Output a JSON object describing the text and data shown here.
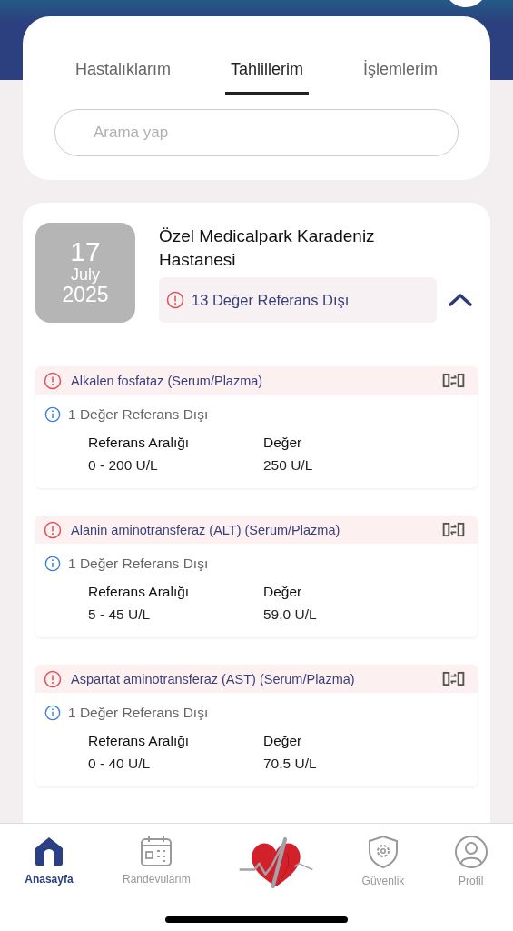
{
  "tabs": [
    {
      "label": "Hastalıklarım",
      "selected": false
    },
    {
      "label": "Tahlillerim",
      "selected": true
    },
    {
      "label": "İşlemlerim",
      "selected": false
    }
  ],
  "search": {
    "placeholder": "Arama yap"
  },
  "visit": {
    "day": "17",
    "month": "July",
    "year": "2025",
    "hospital": "Özel Medicalpark Karadeniz Hastanesi",
    "summary": "13 Değer Referans Dışı",
    "expanded": true
  },
  "tests": [
    {
      "name": "Alkalen fosfataz (Serum/Plazma)",
      "info": "1 Değer Referans Dışı",
      "range_label": "Referans Aralığı",
      "value_label": "Değer",
      "range": "0 - 200 U/L",
      "value": "250 U/L"
    },
    {
      "name": "Alanin aminotransferaz (ALT) (Serum/Plazma)",
      "info": "1 Değer Referans Dışı",
      "range_label": "Referans Aralığı",
      "value_label": "Değer",
      "range": "5 - 45 U/L",
      "value": "59,0 U/L"
    },
    {
      "name": "Aspartat aminotransferaz (AST) (Serum/Plazma)",
      "info": "1 Değer Referans Dışı",
      "range_label": "Referans Aralığı",
      "value_label": "Değer",
      "range": "0 - 40 U/L",
      "value": "70,5 U/L"
    }
  ],
  "nav": [
    {
      "kind": "home",
      "label": "Anasayfa",
      "selected": true
    },
    {
      "kind": "calendar",
      "label": "Randevularım",
      "selected": false
    },
    {
      "kind": "logo"
    },
    {
      "kind": "shield",
      "label": "Güvenlik",
      "selected": false
    },
    {
      "kind": "profile",
      "label": "Profil",
      "selected": false
    }
  ]
}
